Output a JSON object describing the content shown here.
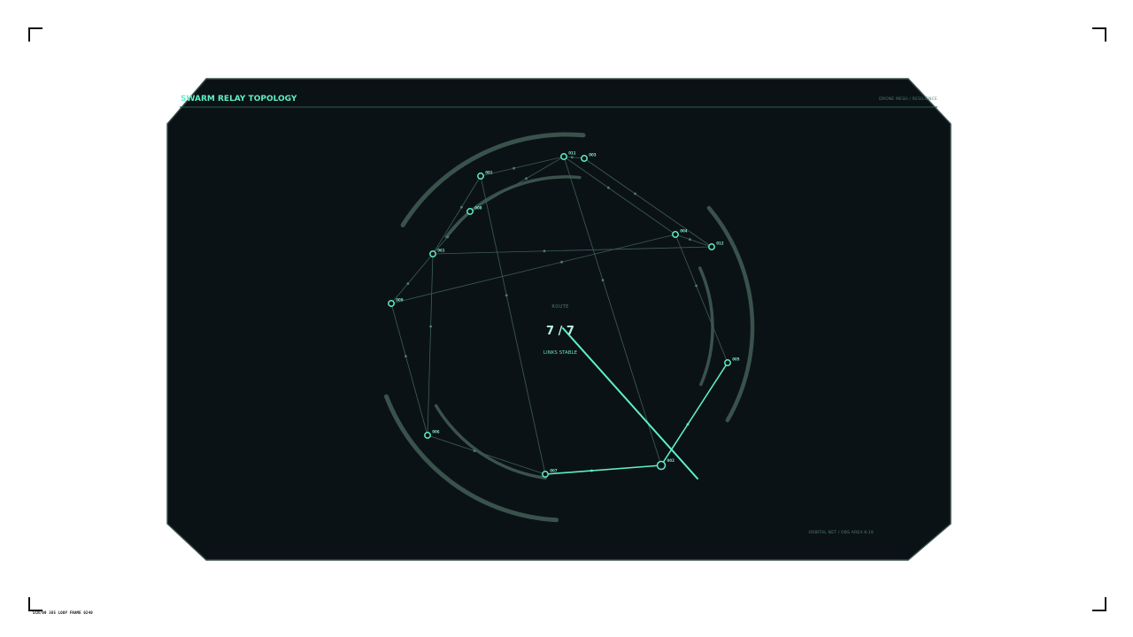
{
  "header": {
    "title": "SWARM RELAY TOPOLOGY",
    "subtitle": "DRONE MESH / RESILIENCE"
  },
  "center": {
    "label": "ROUTE",
    "count": "7 / 7",
    "status": "LINKS STABLE"
  },
  "footer": {
    "location": "ORBITAL NET / OBS AREA K-19",
    "code": "SCN/09 385 LOOP FRAME 0240"
  },
  "colors": {
    "background": "#ffffff",
    "panel": "#0b1216",
    "accent": "#5ff0c5",
    "link": "#3d5e56",
    "arc": "#3a524c"
  },
  "nodes": [
    {
      "id": "011",
      "label": "011"
    },
    {
      "id": "003",
      "label": "003"
    },
    {
      "id": "001",
      "label": "001"
    },
    {
      "id": "008",
      "label": "008"
    },
    {
      "id": "004",
      "label": "004"
    },
    {
      "id": "012",
      "label": "012"
    },
    {
      "id": "061",
      "label": "061"
    },
    {
      "id": "009",
      "label": "009"
    },
    {
      "id": "005",
      "label": "005"
    },
    {
      "id": "006",
      "label": "006"
    },
    {
      "id": "007",
      "label": "007"
    },
    {
      "id": "002",
      "label": "002"
    }
  ],
  "links": [
    {
      "from": "001",
      "to": "011",
      "active": false
    },
    {
      "from": "001",
      "to": "061",
      "active": false
    },
    {
      "from": "001",
      "to": "007",
      "active": false
    },
    {
      "from": "011",
      "to": "003",
      "active": false
    },
    {
      "from": "011",
      "to": "004",
      "active": false
    },
    {
      "from": "011",
      "to": "002",
      "active": false
    },
    {
      "from": "011",
      "to": "008",
      "active": false
    },
    {
      "from": "003",
      "to": "012",
      "active": false
    },
    {
      "from": "004",
      "to": "012",
      "active": false
    },
    {
      "from": "004",
      "to": "005",
      "active": false
    },
    {
      "from": "004",
      "to": "009",
      "active": false
    },
    {
      "from": "061",
      "to": "012",
      "active": false
    },
    {
      "from": "061",
      "to": "006",
      "active": false
    },
    {
      "from": "061",
      "to": "008",
      "active": false
    },
    {
      "from": "009",
      "to": "061",
      "active": false
    },
    {
      "from": "009",
      "to": "006",
      "active": false
    },
    {
      "from": "006",
      "to": "007",
      "active": false
    },
    {
      "from": "007",
      "to": "002",
      "active": true
    },
    {
      "from": "002",
      "to": "005",
      "active": true
    }
  ]
}
